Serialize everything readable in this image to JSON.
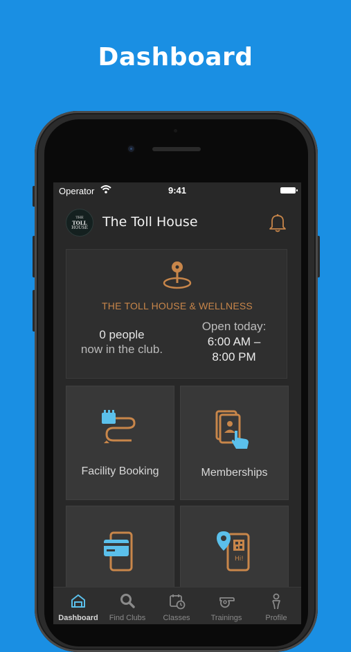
{
  "headline": "Dashboard",
  "status_bar": {
    "operator": "Operator",
    "time": "9:41"
  },
  "header": {
    "logo_text": [
      "THE",
      "TOLL",
      "HOUSE"
    ],
    "club_name": "The Toll House"
  },
  "club_card": {
    "full_name": "THE TOLL HOUSE & WELLNESS",
    "people_count": "0 people",
    "people_suffix": "now in the club.",
    "open_label": "Open today:",
    "open_from": "6:00 AM –",
    "open_to": "8:00 PM"
  },
  "tiles": [
    {
      "label": "Facility Booking",
      "icon": "calendar-path-icon"
    },
    {
      "label": "Memberships",
      "icon": "membership-card-icon"
    },
    {
      "label": "",
      "icon": "payment-card-phone-icon"
    },
    {
      "label": "",
      "icon": "location-qr-phone-icon"
    }
  ],
  "tabs": [
    {
      "label": "Dashboard",
      "icon": "home-icon",
      "active": true
    },
    {
      "label": "Find Clubs",
      "icon": "search-icon",
      "active": false
    },
    {
      "label": "Classes",
      "icon": "calendar-clock-icon",
      "active": false
    },
    {
      "label": "Trainings",
      "icon": "whistle-icon",
      "active": false
    },
    {
      "label": "Profile",
      "icon": "person-icon",
      "active": false
    }
  ],
  "colors": {
    "background": "#1a8fe3",
    "accent_orange": "#c8864a",
    "accent_blue": "#5bc0eb",
    "screen_bg": "#282828"
  }
}
